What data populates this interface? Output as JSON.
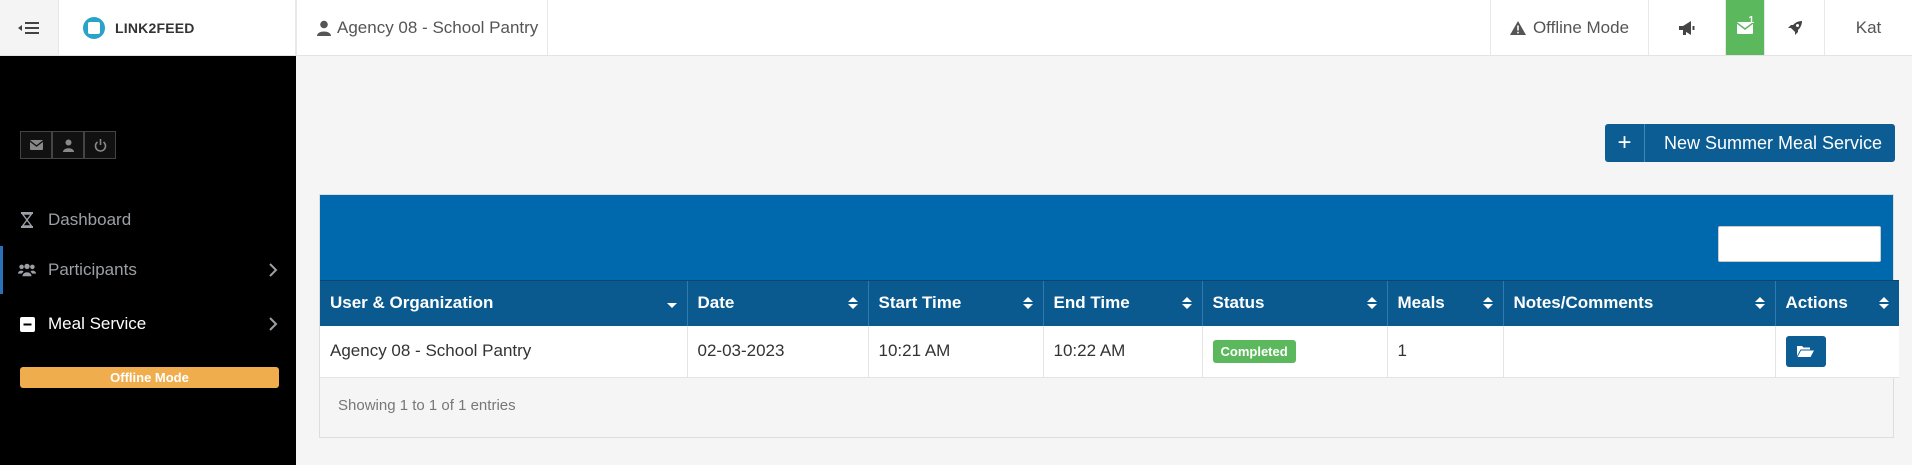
{
  "topbar": {
    "brand": "LINK2FEED",
    "agency": "Agency 08 - School Pantry",
    "offline_mode": "Offline Mode",
    "mail_count": "1",
    "user": "Kat"
  },
  "sidebar": {
    "items": [
      {
        "label": "Dashboard",
        "icon": "hourglass-icon"
      },
      {
        "label": "Participants",
        "icon": "users-icon"
      },
      {
        "label": "Meal Service",
        "icon": "minus-square-icon"
      }
    ],
    "offline_badge": "Offline Mode"
  },
  "main": {
    "new_button": "New Summer Meal Service",
    "search": {
      "value": "",
      "placeholder": ""
    },
    "table": {
      "columns": [
        "User & Organization",
        "Date",
        "Start Time",
        "End Time",
        "Status",
        "Meals",
        "Notes/Comments",
        "Actions"
      ],
      "rows": [
        {
          "organization": "Agency 08 - School Pantry",
          "date": "02-03-2023",
          "start_time": "10:21 AM",
          "end_time": "10:22 AM",
          "status": "Completed",
          "meals": "1",
          "notes": ""
        }
      ]
    },
    "footer": "Showing 1 to 1 of 1 entries"
  },
  "colors": {
    "primary": "#0068ac",
    "header": "#0a5a8f",
    "success": "#5cb85c",
    "warning": "#f0ad4e",
    "sidebar": "#000000"
  }
}
